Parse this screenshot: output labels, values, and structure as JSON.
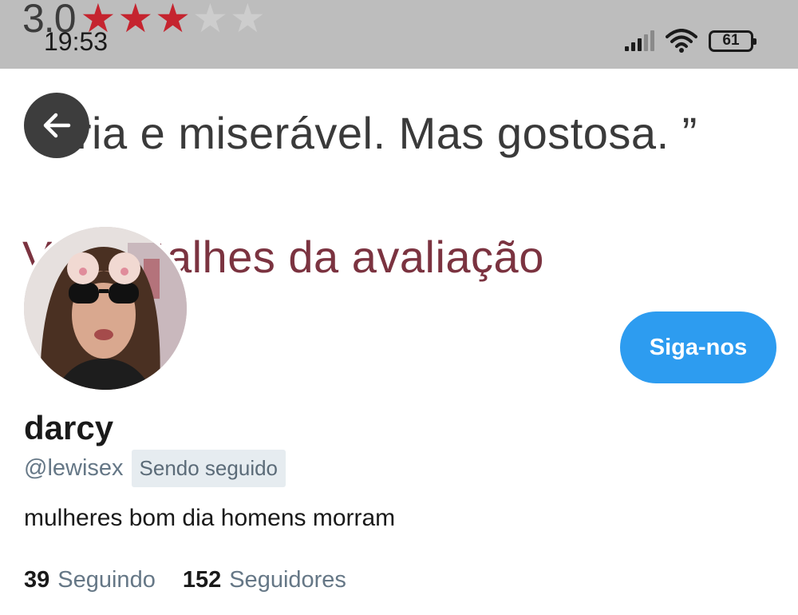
{
  "status_bar": {
    "rating_value": "3.0",
    "rating_stars_filled": 3,
    "rating_stars_total": 5,
    "time": "19:53",
    "battery": "61"
  },
  "banner": {
    "quote": "“Fria e miserável. Mas gostosa. ”",
    "subtitle": "Ver detalhes da avaliação"
  },
  "profile": {
    "follow_label": "Siga-nos",
    "display_name": "darcy",
    "handle": "@lewisex",
    "follows_you_badge": "Sendo seguido",
    "bio": "mulheres bom dia homens morram",
    "following_count": "39",
    "following_label": "Seguindo",
    "followers_count": "152",
    "followers_label": "Seguidores"
  },
  "colors": {
    "accent": "#2d9cf0",
    "star": "#c5242f",
    "secondary_text": "#657786"
  },
  "icons": {
    "back": "arrow-left-icon",
    "signal": "cell-signal-icon",
    "wifi": "wifi-icon",
    "battery": "battery-icon"
  }
}
